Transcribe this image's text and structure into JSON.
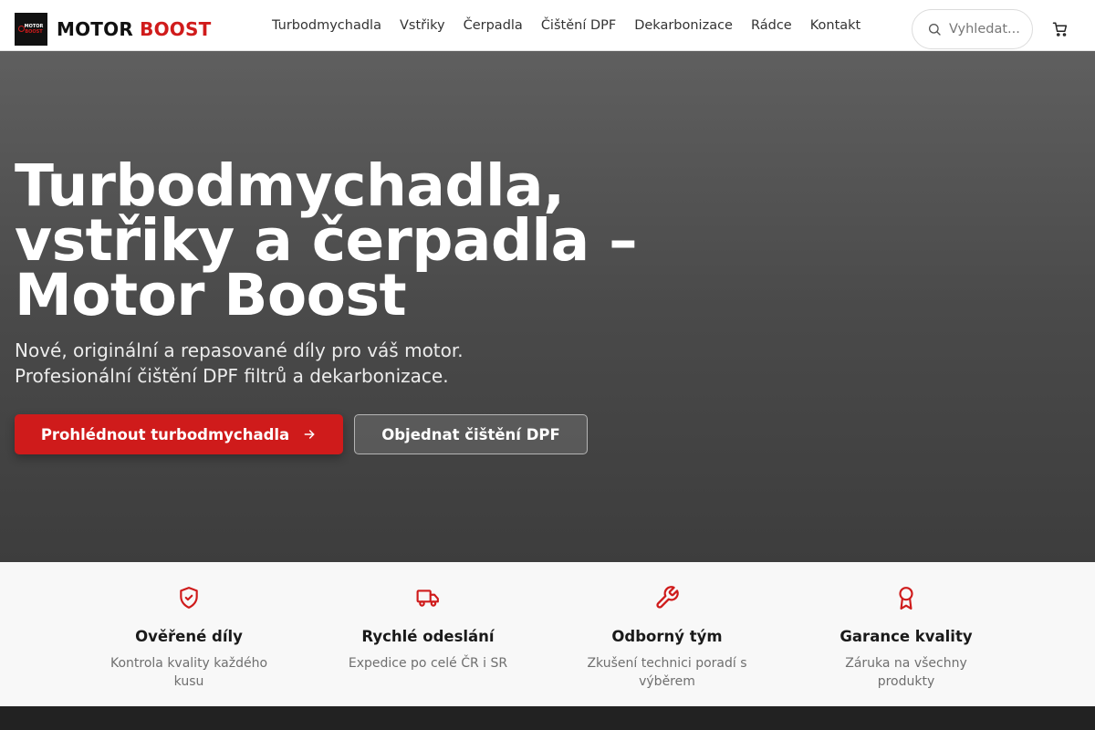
{
  "brand": {
    "badge_line1": "MOTOR",
    "badge_line2": "BOOST",
    "word1": "MOTOR",
    "word2": "BOOST",
    "accent_color": "#d01b1b"
  },
  "nav": {
    "items": [
      {
        "label": "Turbodmychadla"
      },
      {
        "label": "Vstřiky"
      },
      {
        "label": "Čerpadla"
      },
      {
        "label": "Čištění DPF"
      },
      {
        "label": "Dekarbonizace"
      },
      {
        "label": "Rádce"
      },
      {
        "label": "Kontakt"
      }
    ]
  },
  "search": {
    "placeholder": "Vyhledat...",
    "value": "",
    "icon": "search-icon"
  },
  "cart": {
    "icon": "cart-icon"
  },
  "hero": {
    "title": "Turbodmychadla, vstřiky a čerpadla – Motor Boost",
    "subtitle_line1": "Nové, originální a repasované díly pro váš motor.",
    "subtitle_line2": "Profesionální čištění DPF filtrů a dekarbonizace.",
    "primary_button": "Prohlédnout turbodmychadla",
    "secondary_button": "Objednat čištění DPF"
  },
  "features": [
    {
      "icon": "shield-check-icon",
      "title": "Ověřené díly",
      "description": "Kontrola kvality každého kusu"
    },
    {
      "icon": "truck-icon",
      "title": "Rychlé odeslání",
      "description": "Expedice po celé ČR i SR"
    },
    {
      "icon": "wrench-icon",
      "title": "Odborný tým",
      "description": "Zkušení technici poradí s výběrem"
    },
    {
      "icon": "award-icon",
      "title": "Garance kvality",
      "description": "Záruka na všechny produkty"
    }
  ]
}
